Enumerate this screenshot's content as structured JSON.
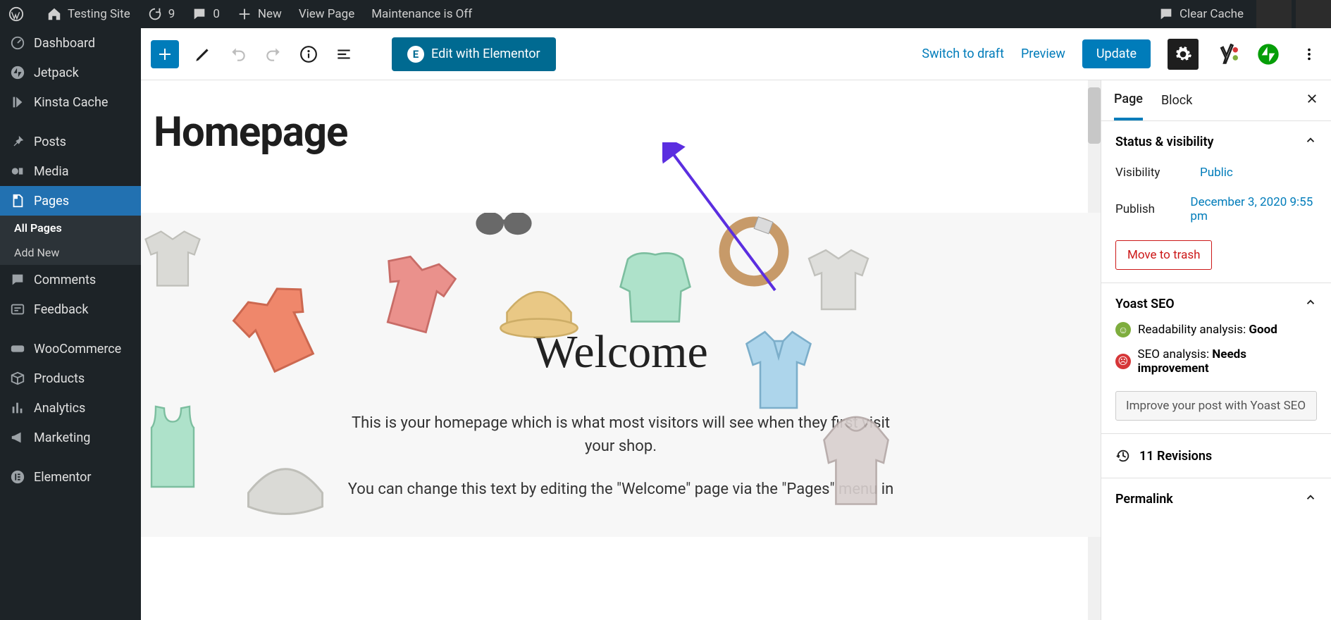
{
  "adminbar": {
    "site_name": "Testing Site",
    "updates_count": "9",
    "comments_count": "0",
    "new_label": "New",
    "view_page_label": "View Page",
    "maintenance_label": "Maintenance is Off",
    "clear_cache_label": "Clear Cache"
  },
  "sidenav": {
    "dashboard": "Dashboard",
    "jetpack": "Jetpack",
    "kinsta": "Kinsta Cache",
    "posts": "Posts",
    "media": "Media",
    "pages": "Pages",
    "pages_sub": {
      "all": "All Pages",
      "add": "Add New"
    },
    "comments": "Comments",
    "feedback": "Feedback",
    "woo": "WooCommerce",
    "products": "Products",
    "analytics": "Analytics",
    "marketing": "Marketing",
    "elementor": "Elementor"
  },
  "toolbar": {
    "elementor_label": "Edit with Elementor",
    "switch_draft": "Switch to draft",
    "preview": "Preview",
    "update": "Update"
  },
  "page": {
    "title": "Homepage",
    "hero_heading": "Welcome",
    "hero_p1": "This is your homepage which is what most visitors will see when they first visit your shop.",
    "hero_p2": "You can change this text by editing the \"Welcome\" page via the \"Pages\" menu in"
  },
  "settings": {
    "tab_page": "Page",
    "tab_block": "Block",
    "panel_status": "Status & visibility",
    "visibility_label": "Visibility",
    "visibility_value": "Public",
    "publish_label": "Publish",
    "publish_value": "December 3, 2020 9:55 pm",
    "trash": "Move to trash",
    "yoast_heading": "Yoast SEO",
    "readability_label": "Readability analysis:",
    "readability_value": "Good",
    "seo_label": "SEO analysis:",
    "seo_value": "Needs improvement",
    "improve_btn": "Improve your post with Yoast SEO",
    "revisions": "11 Revisions",
    "permalink": "Permalink"
  }
}
